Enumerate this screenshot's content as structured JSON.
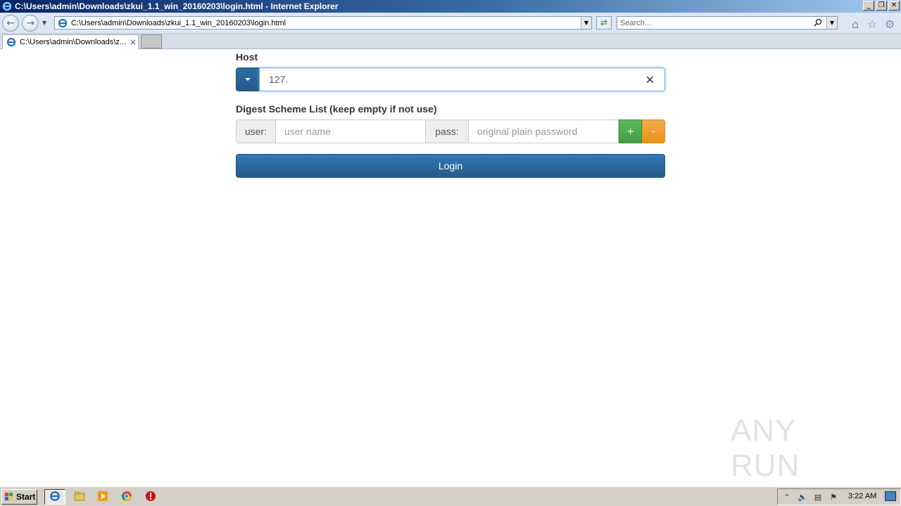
{
  "window": {
    "title": "C:\\Users\\admin\\Downloads\\zkui_1.1_win_20160203\\login.html - Internet Explorer",
    "controls": {
      "minimize": "_",
      "maximize": "❐",
      "close": "✕"
    }
  },
  "navbar": {
    "back_icon": "back-arrow-icon",
    "forward_icon": "forward-arrow-icon",
    "address": "C:\\Users\\admin\\Downloads\\zkui_1.1_win_20160203\\login.html",
    "search_placeholder": "Search...",
    "icons": [
      "home-icon",
      "star-icon",
      "gear-icon"
    ]
  },
  "tabs": [
    {
      "label": "C:\\Users\\admin\\Downloads\\z...",
      "close": "×"
    }
  ],
  "form": {
    "host_label": "Host",
    "host_value": "127.",
    "host_clear": "✕",
    "digest_label": "Digest Scheme List (keep empty if not use)",
    "user_addon": "user:",
    "user_placeholder": "user name",
    "pass_addon": "pass:",
    "pass_placeholder": "original plain password",
    "add_label": "+",
    "remove_label": "–",
    "login_label": "Login"
  },
  "colors": {
    "primary": "#337ab7",
    "success": "#5cb85c",
    "warning": "#f0ad4e",
    "focus": "#66afe9"
  },
  "taskbar": {
    "start_label": "Start",
    "clock": "3:22 AM"
  },
  "watermark": "ANY RUN"
}
